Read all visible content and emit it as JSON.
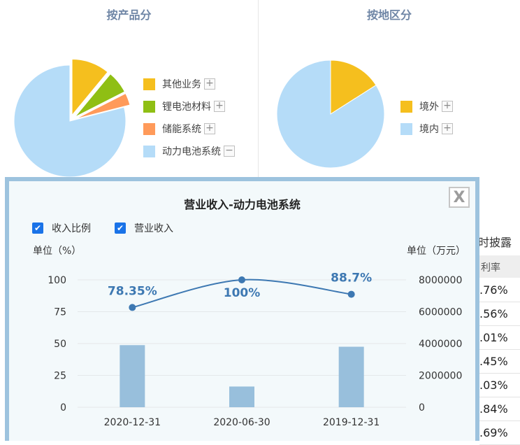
{
  "product_panel": {
    "title": "按产品分",
    "legend": [
      {
        "label": "其他业务",
        "color": "#f5bf1e",
        "toggle": "+"
      },
      {
        "label": "锂电池材料",
        "color": "#8fbf14",
        "toggle": "+"
      },
      {
        "label": "储能系统",
        "color": "#ff9a5a",
        "toggle": "+"
      },
      {
        "label": "动力电池系统",
        "color": "#b5dcf8",
        "toggle": "−"
      }
    ]
  },
  "region_panel": {
    "title": "按地区分",
    "legend": [
      {
        "label": "境外",
        "color": "#f5bf1e",
        "toggle": "+"
      },
      {
        "label": "境内",
        "color": "#b5dcf8",
        "toggle": "+"
      }
    ]
  },
  "background": {
    "right_header": "时披露",
    "right_col_header": "利率",
    "right_values": [
      ".76%",
      ".56%",
      ".01%",
      ".45%",
      ".03%",
      ".84%",
      ".69%"
    ]
  },
  "modal": {
    "title": "营业收入-动力电池系统",
    "close_label": "X",
    "checkboxes": [
      {
        "label": "收入比例",
        "checked": true
      },
      {
        "label": "营业收入",
        "checked": true
      }
    ],
    "left_unit": "单位（%）",
    "right_unit": "单位（万元）"
  },
  "chart_data": [
    {
      "type": "pie",
      "title": "按产品分",
      "labels": [
        "其他业务",
        "锂电池材料",
        "储能系统",
        "动力电池系统"
      ],
      "values": [
        11.0,
        6.5,
        3.5,
        79.0
      ],
      "colors": [
        "#f5bf1e",
        "#8fbf14",
        "#ff9a5a",
        "#b5dcf8"
      ],
      "exploded": [
        "其他业务",
        "锂电池材料",
        "储能系统"
      ]
    },
    {
      "type": "pie",
      "title": "按地区分",
      "labels": [
        "境外",
        "境内"
      ],
      "values": [
        16,
        84
      ],
      "colors": [
        "#f5bf1e",
        "#b5dcf8"
      ]
    },
    {
      "type": "bar+line",
      "title": "营业收入-动力电池系统",
      "categories": [
        "2020-12-31",
        "2020-06-30",
        "2019-12-31"
      ],
      "series": [
        {
          "name": "收入比例",
          "type": "line",
          "axis": "left",
          "values": [
            78.35,
            100,
            88.7
          ],
          "labels": [
            "78.35%",
            "100%",
            "88.7%"
          ],
          "color": "#3d78b2"
        },
        {
          "name": "营业收入",
          "type": "bar",
          "axis": "right",
          "values": [
            3900000,
            1300000,
            3800000
          ],
          "color": "#98bfdc"
        }
      ],
      "left_axis": {
        "label": "单位（%）",
        "ticks": [
          0,
          25,
          50,
          75,
          100
        ],
        "lim": [
          0,
          100
        ]
      },
      "right_axis": {
        "label": "单位（万元）",
        "ticks": [
          0,
          2000000,
          4000000,
          6000000,
          8000000
        ],
        "lim": [
          0,
          8000000
        ]
      },
      "left_axis_ymin": 15,
      "grid": true
    }
  ]
}
